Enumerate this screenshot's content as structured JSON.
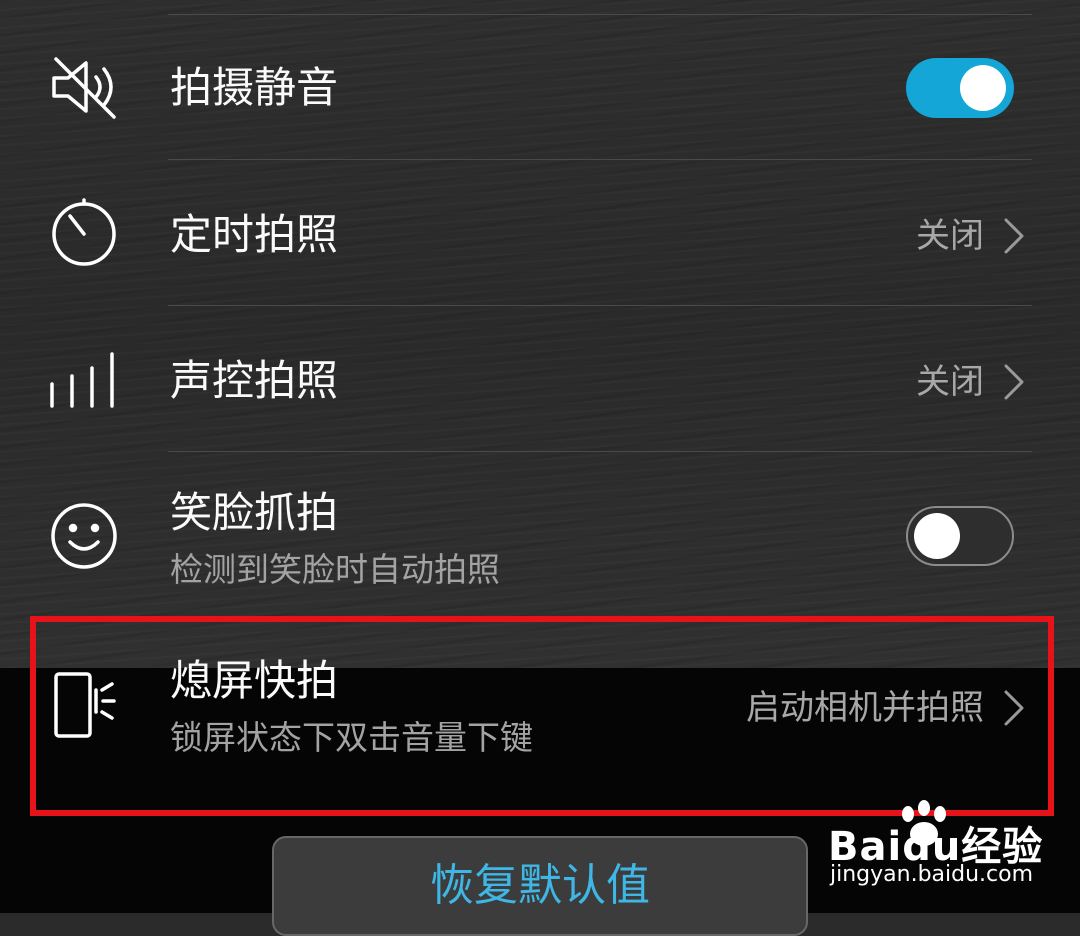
{
  "settings": [
    {
      "title": "拍摄静音",
      "control": "toggle",
      "on": true,
      "icon": "mute-speaker-icon"
    },
    {
      "title": "定时拍照",
      "value": "关闭",
      "icon": "timer-icon"
    },
    {
      "title": "声控拍照",
      "value": "关闭",
      "icon": "audio-bars-icon"
    },
    {
      "title": "笑脸抓拍",
      "subtitle": "检测到笑脸时自动拍照",
      "control": "toggle",
      "on": false,
      "icon": "smile-icon"
    },
    {
      "title": "熄屏快拍",
      "subtitle": "锁屏状态下双击音量下键",
      "value": "启动相机并拍照",
      "icon": "phone-volume-key-icon"
    }
  ],
  "reset_button": "恢复默认值",
  "watermark": {
    "logo_text": "Baidu经验",
    "url": "jingyan.baidu.com"
  },
  "colors": {
    "accent": "#14a6d6",
    "highlight": "#e8121a",
    "reset_text": "#3fb7e6"
  }
}
